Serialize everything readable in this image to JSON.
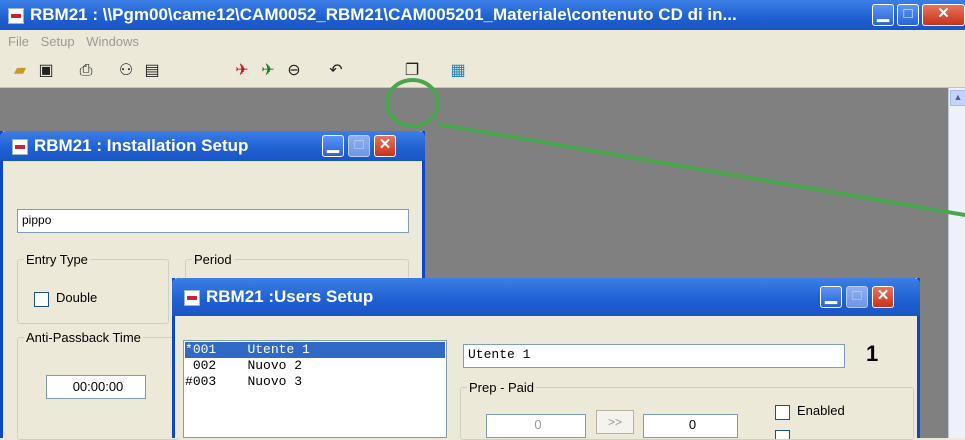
{
  "main_window": {
    "title": "RBM21 : \\\\Pgm00\\came12\\CAM0052_RBM21\\CAM005201_Materiale\\contenuto CD di in...",
    "menu": [
      "File",
      "Setup",
      "Windows"
    ],
    "toolbar_icons": [
      "open-folder-icon",
      "save-icon",
      "print-icon",
      "network-icon",
      "properties-icon",
      "pin-red-icon",
      "pin-green-icon",
      "minus-circle-icon",
      "undo-icon",
      "cascade-windows-icon",
      "floppy-blue-icon"
    ]
  },
  "installation_setup": {
    "title": "RBM21 : Installation Setup",
    "name_value": "pippo",
    "entry_type_label": "Entry Type",
    "double_label": "Double",
    "period_label": "Period",
    "anti_passback_label": "Anti-Passback Time",
    "anti_passback_value": "00:00:00"
  },
  "users_setup": {
    "title": "RBM21 :Users Setup",
    "users": [
      {
        "marker": "*",
        "code": "001",
        "name": "Utente 1",
        "selected": true
      },
      {
        "marker": " ",
        "code": "002",
        "name": "Nuovo 2",
        "selected": false
      },
      {
        "marker": "#",
        "code": "003",
        "name": "Nuovo 3",
        "selected": false
      }
    ],
    "user_name_value": "Utente 1",
    "user_number": "1",
    "prep_paid_label": "Prep - Paid",
    "prep_value_1": "0",
    "transfer_button": ">>",
    "prep_value_2": "0",
    "enabled_label": "Enabled"
  },
  "annotation": {
    "color": "#49a64e",
    "target": "cascade-windows-icon"
  }
}
